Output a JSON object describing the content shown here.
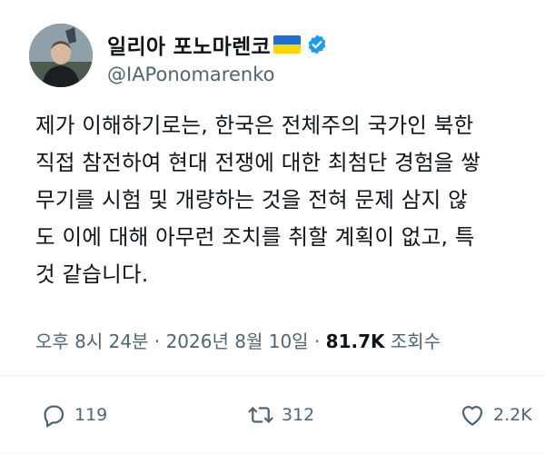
{
  "author": {
    "display_name": "일리아 포노마렌코",
    "handle": "@IAPonomarenko",
    "flag_icon": "ukraine-flag-icon",
    "verified_icon": "verified-badge-icon",
    "verified_color": "#1d9bf0"
  },
  "tweet": {
    "lines": [
      "제가 이해하기로는, 한국은 전체주의 국가인 북한",
      "직접 참전하여 현대 전쟁에 대한 최첨단 경험을 쌓",
      "무기를 시험 및 개량하는 것을 전혀 문제 삼지 않",
      "도 이에 대해 아무런 조치를 취할 계획이 없고, 특",
      "것 같습니다."
    ]
  },
  "meta": {
    "time": "오후 8시 24분",
    "separator": "·",
    "date": "2026년 8월 10일",
    "views_count": "81.7K",
    "views_label": "조회수"
  },
  "actions": {
    "replies": "119",
    "reposts": "312",
    "likes": "2.2K"
  }
}
